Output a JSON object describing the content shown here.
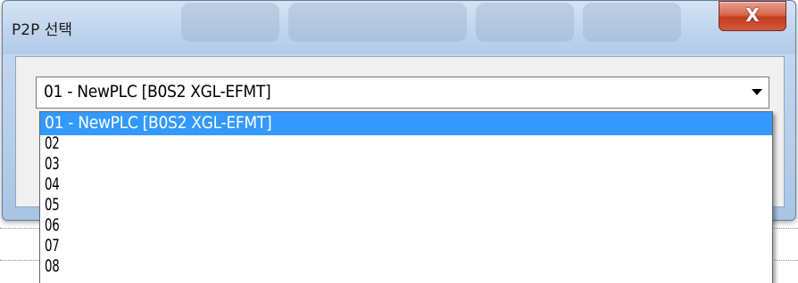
{
  "dialog": {
    "title": "P2P 선택",
    "close_glyph": "X"
  },
  "combo": {
    "selected_value": "01 - NewPLC [B0S2 XGL-EFMT]"
  },
  "dropdown": {
    "options": [
      "01 - NewPLC [B0S2 XGL-EFMT]",
      "02",
      "03",
      "04",
      "05",
      "06",
      "07",
      "08"
    ],
    "selected_index": 0
  },
  "colors": {
    "selection": "#3399ff",
    "close_button": "#c43c20",
    "title_bar": "#c3d7ee"
  },
  "icons": {
    "combo_arrow": "chevron-down-icon",
    "close": "close-icon"
  }
}
